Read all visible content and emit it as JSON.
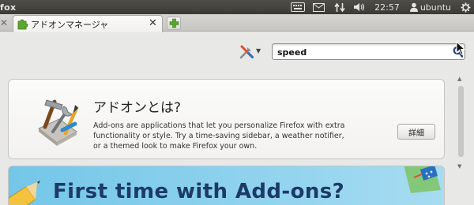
{
  "window": {
    "app_title": "fox"
  },
  "panel": {
    "clock": "22:57",
    "username": "ubuntu"
  },
  "tabs": {
    "active": {
      "label": "アドオンマネージャ"
    }
  },
  "search": {
    "value": "speed"
  },
  "intro": {
    "title": "アドオンとは?",
    "body": "Add-ons are applications that let you personalize Firefox with extra functionality or style. Try a time-saving sidebar, a weather notifier, or a themed look to make Firefox your own.",
    "learn_more_label": "詳細"
  },
  "banner": {
    "title": "First time with Add-ons?"
  },
  "icons": {
    "panel": [
      "keyboard-icon",
      "mail-icon",
      "network-icon",
      "volume-icon",
      "user-icon",
      "session-icon"
    ],
    "tab": [
      "addon-icon",
      "close-icon",
      "plus-icon"
    ],
    "toolbar": [
      "tools-icon",
      "chevron-down-icon",
      "search-icon",
      "cursor-icon"
    ]
  },
  "colors": {
    "panel_bg": "#3b3a36",
    "accent_green": "#5aa62f",
    "banner_bg": "#74c6e8",
    "banner_text": "#1c3a66"
  }
}
